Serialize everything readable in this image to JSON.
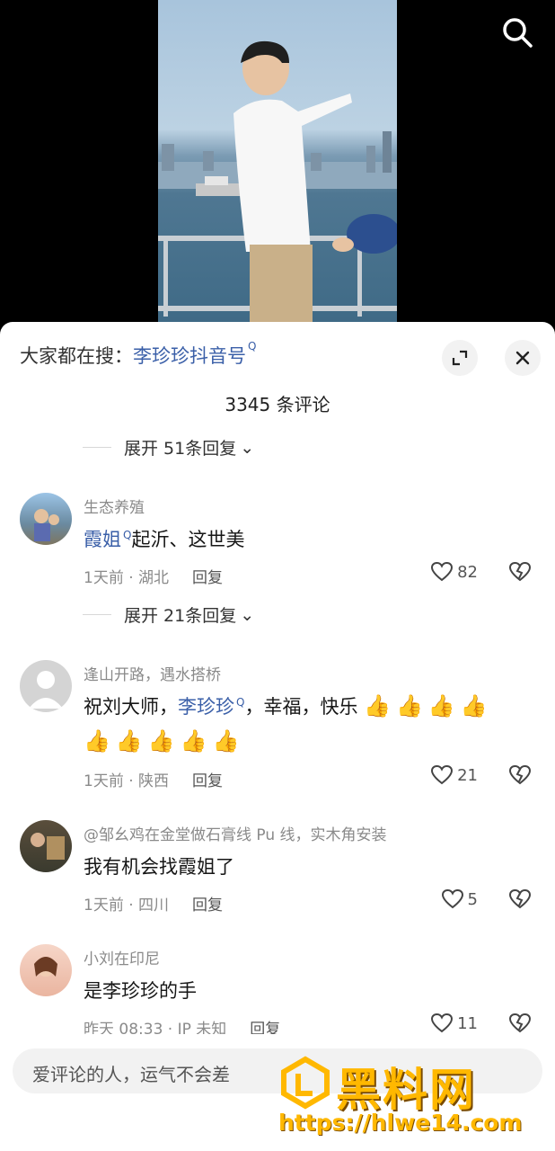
{
  "header": {
    "search_hint_prefix": "大家都在搜：",
    "search_hint_keyword": "李珍珍抖音号",
    "search_sup": "Q",
    "comment_count_text": "3345 条评论"
  },
  "top_expand": {
    "label": "展开 51条回复",
    "chevron": "⌄"
  },
  "comments": [
    {
      "author": "生态养殖",
      "mention": "霞姐",
      "mention_sup": "Q",
      "text_after": "起沂、这世美",
      "meta": "1天前 · 湖北",
      "reply": "回复",
      "likes": "82",
      "expand_label": "展开 21条回复"
    },
    {
      "author": "逢山开路，遇水搭桥",
      "text_before": "祝刘大师，",
      "mention": "李珍珍",
      "mention_sup": "Q",
      "text_after": "，幸福，快乐",
      "emoji": "👍",
      "meta": "1天前 · 陕西",
      "reply": "回复",
      "likes": "21"
    },
    {
      "author": "@邹幺鸡在金堂做石膏线 Pu 线，实木角安装",
      "text": "我有机会找霞姐了",
      "meta": "1天前 · 四川",
      "reply": "回复",
      "likes": "5"
    },
    {
      "author": "小刘在印尼",
      "text": "是李珍珍的手",
      "meta": "昨天 08:33 · IP 未知",
      "reply": "回复",
      "likes": "11"
    }
  ],
  "input": {
    "placeholder": "爱评论的人，运气不会差"
  },
  "watermark": {
    "title": "黑料网",
    "url": "https://hlwe14.com"
  },
  "colors": {
    "accent_blue": "#3a5fa8",
    "watermark_gold": "#ffb800"
  },
  "icons": [
    "search-icon",
    "collapse-icon",
    "close-icon",
    "heart-icon",
    "broken-heart-icon",
    "chevron-down-icon",
    "thumbs-up-emoji"
  ]
}
